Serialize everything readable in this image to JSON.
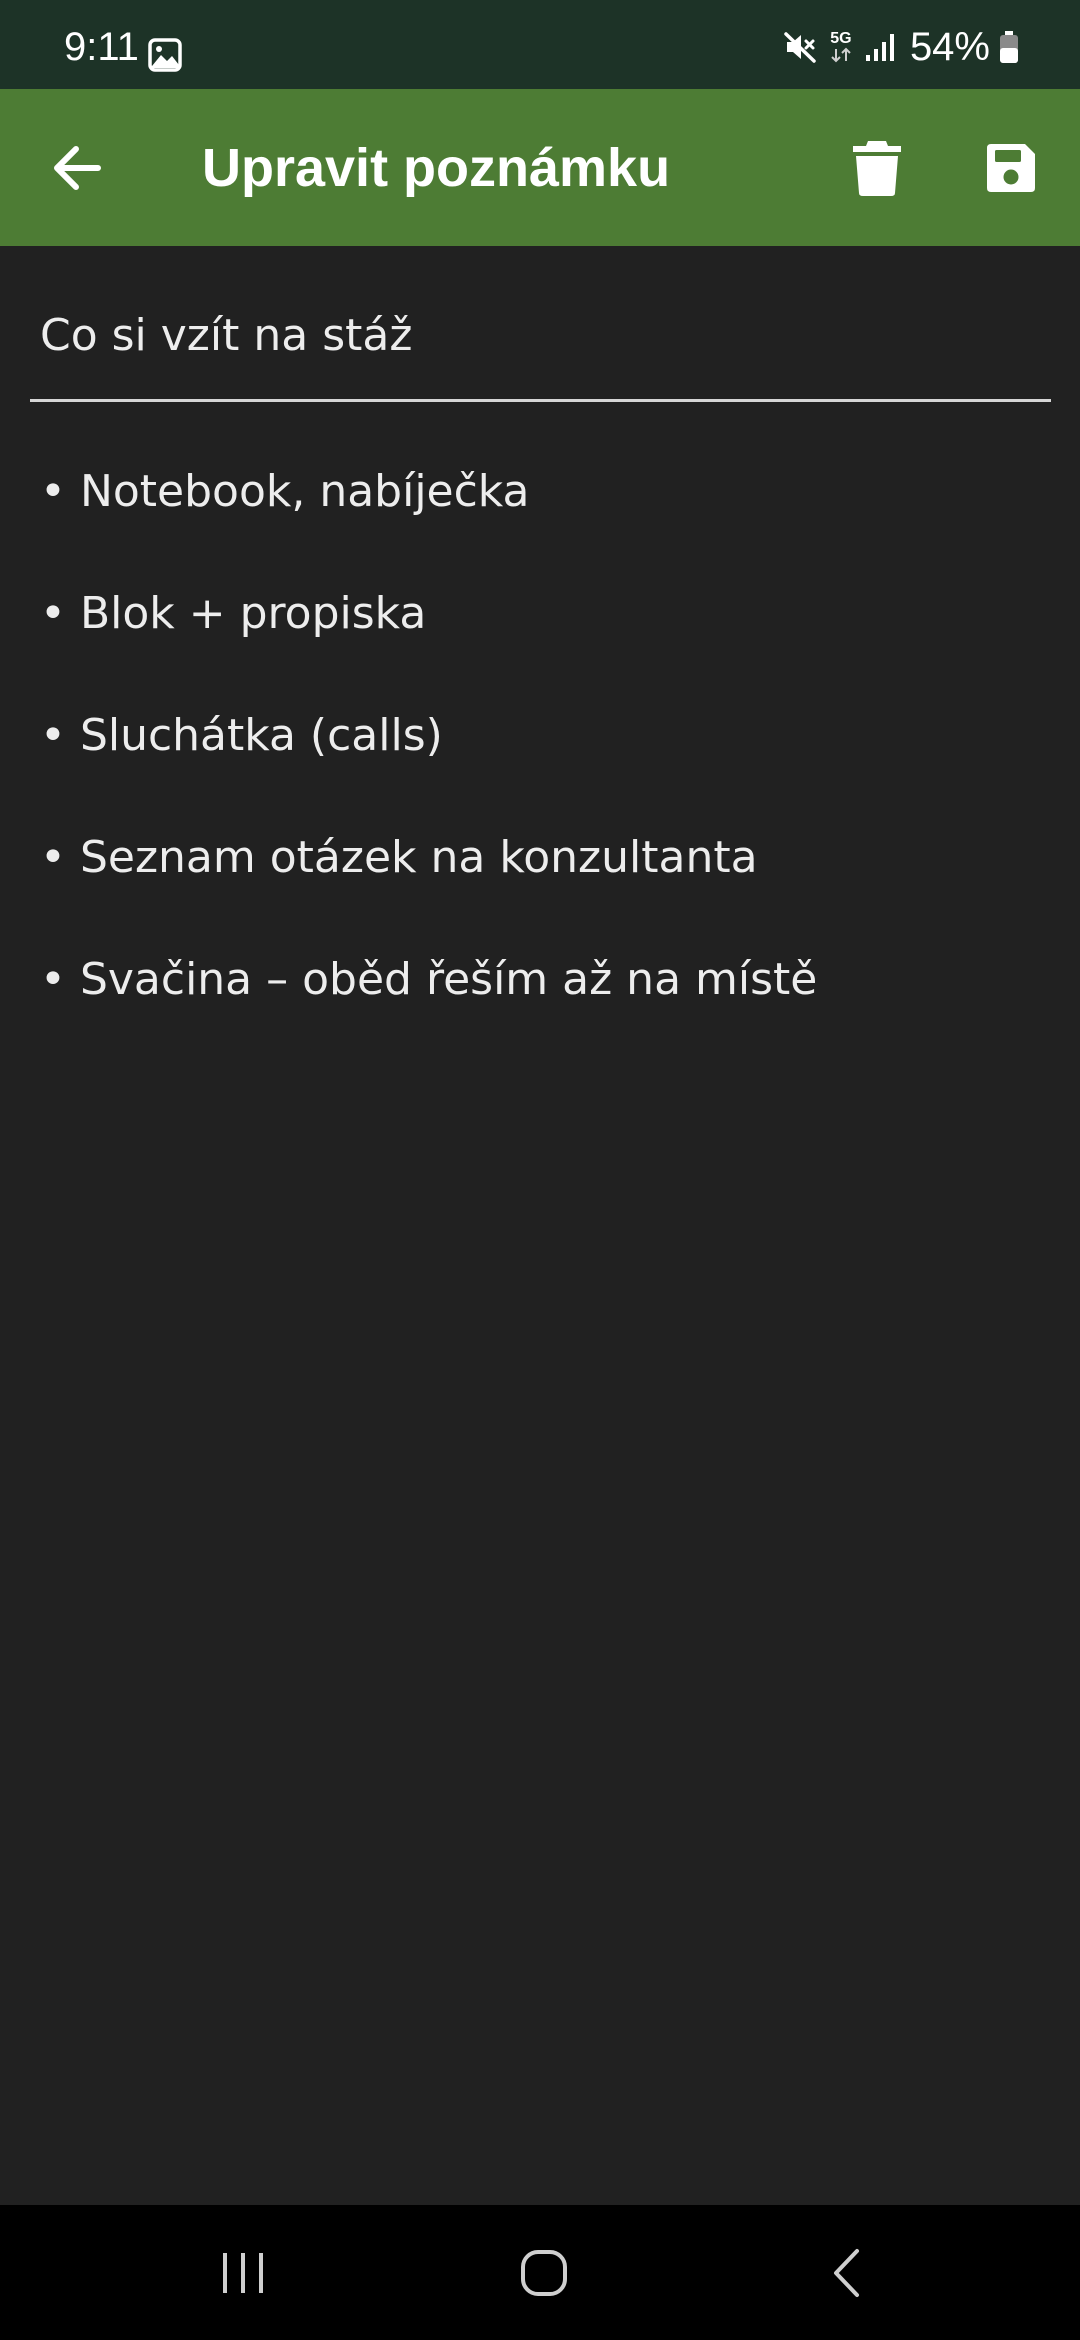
{
  "status_bar": {
    "time": "9:11",
    "network": "5G",
    "battery": "54%"
  },
  "toolbar": {
    "title": "Upravit poznámku",
    "back_icon": "arrow-left-icon",
    "delete_icon": "trash-icon",
    "save_icon": "floppy-disk-icon"
  },
  "note": {
    "title": "Co si vzít na stáž",
    "lines": [
      "• Notebook, nabíječka",
      "• Blok + propiska",
      "• Sluchátka (calls)",
      "• Seznam otázek na konzultanta",
      "• Svačina – oběd řeším až na místě"
    ]
  },
  "colors": {
    "status_bar_bg": "#1d3327",
    "toolbar_bg": "#4d7c34",
    "page_bg": "#212121",
    "text": "#ededed",
    "nav_bar_bg": "#000000"
  }
}
